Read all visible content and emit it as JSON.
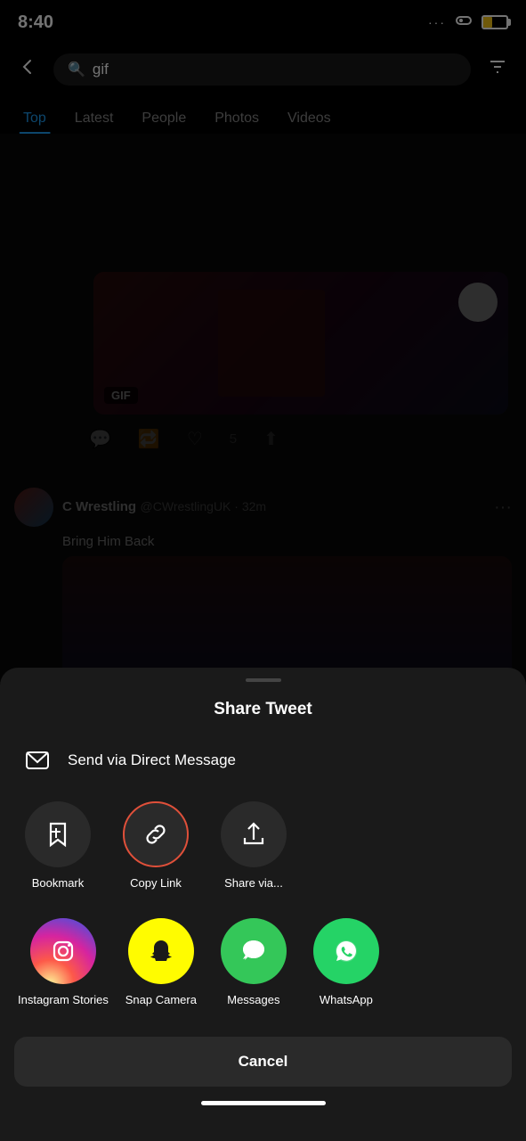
{
  "statusBar": {
    "time": "8:40",
    "icons": {
      "dots": "···",
      "link": "⌀",
      "battery": "battery"
    }
  },
  "searchBar": {
    "back": "←",
    "query": "gif",
    "placeholder": "gif",
    "filterIcon": "filter"
  },
  "tabs": [
    {
      "label": "Top",
      "active": true
    },
    {
      "label": "Latest",
      "active": false
    },
    {
      "label": "People",
      "active": false
    },
    {
      "label": "Photos",
      "active": false
    },
    {
      "label": "Videos",
      "active": false
    }
  ],
  "tweet1": {
    "gifBadge": "GIF"
  },
  "tweet2": {
    "author": "C Wrestling",
    "handle": "@CWrestlingUK",
    "time": "32m",
    "text": "Bring Him Back"
  },
  "bottomSheet": {
    "title": "Share Tweet",
    "dmLabel": "Send via Direct Message",
    "actions": [
      {
        "id": "bookmark",
        "label": "Bookmark"
      },
      {
        "id": "copy-link",
        "label": "Copy Link",
        "selected": true
      },
      {
        "id": "share-via",
        "label": "Share via..."
      }
    ],
    "apps": [
      {
        "id": "instagram",
        "label": "Instagram Stories"
      },
      {
        "id": "snapchat",
        "label": "Snap Camera"
      },
      {
        "id": "messages",
        "label": "Messages"
      },
      {
        "id": "whatsapp",
        "label": "WhatsApp"
      }
    ],
    "cancelLabel": "Cancel"
  }
}
